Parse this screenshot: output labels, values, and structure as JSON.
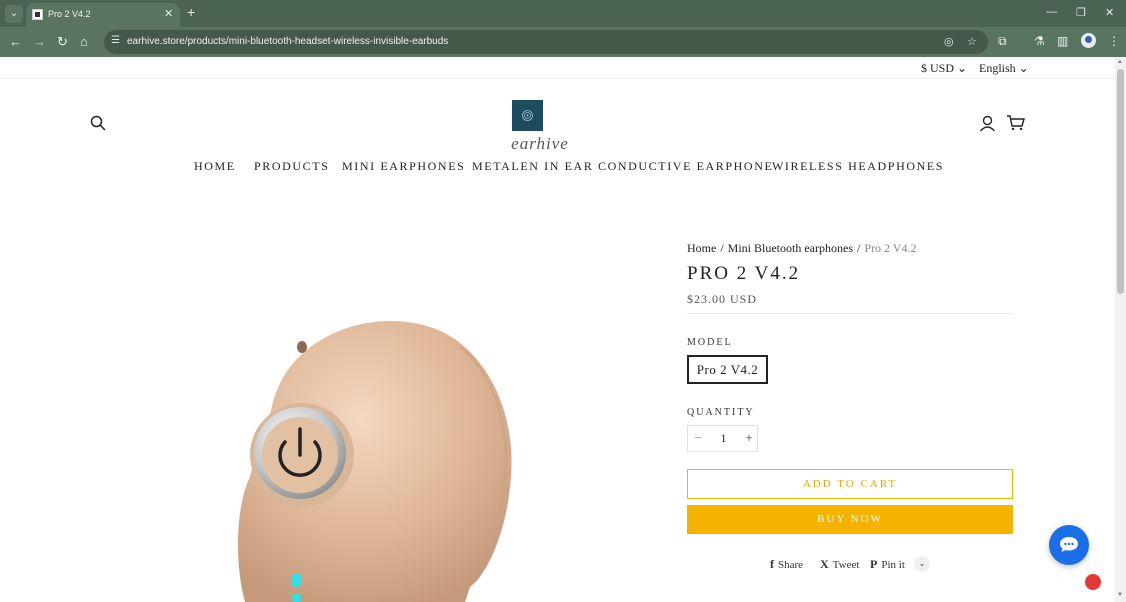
{
  "browser": {
    "tab_title": "Pro 2 V4.2",
    "tab_close": "✕",
    "new_tab": "+",
    "tab_list": "⌄",
    "url": "earhive.store/products/mini-bluetooth-headset-wireless-invisible-earbuds",
    "nav": {
      "back": "←",
      "forward": "→",
      "reload": "↻",
      "home": "⌂"
    },
    "window": {
      "minimize": "—",
      "restore": "❐",
      "close": "✕"
    },
    "menu": "⋮"
  },
  "utility": {
    "currency": "$ USD",
    "language": "English",
    "chevron": "⌄"
  },
  "header": {
    "logo_text": "earhive"
  },
  "nav": {
    "items": [
      {
        "label": "HOME"
      },
      {
        "label": "PRODUCTS"
      },
      {
        "label": "MINI EARPHONES"
      },
      {
        "label": "METALEN IN EAR"
      },
      {
        "label": "CONDUCTIVE EARPHONE"
      },
      {
        "label": "WIRELESS HEADPHONES"
      }
    ]
  },
  "product": {
    "breadcrumb": {
      "home": "Home",
      "category": "Mini Bluetooth earphones",
      "current": "Pro 2 V4.2",
      "separator": "/"
    },
    "title": "PRO 2 V4.2",
    "price": "$23.00 USD",
    "model_label": "MODEL",
    "model_value": "Pro 2 V4.2",
    "quantity_label": "QUANTITY",
    "quantity_value": "1",
    "qty_minus": "−",
    "qty_plus": "+",
    "add_to_cart": "ADD TO CART",
    "buy_now": "BUY NOW"
  },
  "share": {
    "share_label": "Share",
    "tweet_label": "Tweet",
    "pin_label": "Pin it",
    "share_icon": "f",
    "tweet_icon": "X",
    "pin_icon": "P",
    "more_icon": "⌄"
  },
  "colors": {
    "chrome": "#4a6352",
    "accent": "#f5b300",
    "logo": "#1e4b5e",
    "chat": "#1a6fe8"
  }
}
